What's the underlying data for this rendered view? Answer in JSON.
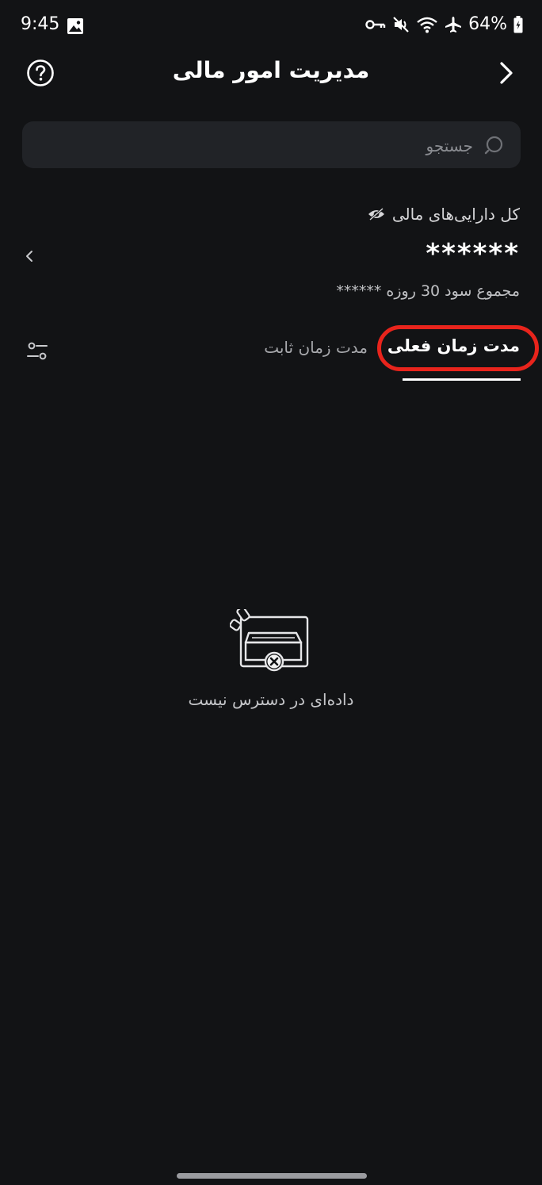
{
  "status_bar": {
    "time": "9:45",
    "battery_percent": "64%",
    "icons": [
      "gallery-icon",
      "vpn-key-icon",
      "muted-icon",
      "wifi-icon",
      "airplane-icon",
      "battery-icon"
    ]
  },
  "header": {
    "title": "مدیریت امور مالی",
    "help_icon": "question-circle-icon",
    "back_icon": "chevron-right-icon"
  },
  "search": {
    "placeholder": "جستجو",
    "value": ""
  },
  "assets": {
    "label": "کل دارایی‌های مالی",
    "value": "******",
    "profit_label": "مجموع سود 30 روزه",
    "profit_value": "******"
  },
  "tabs": [
    {
      "label": "مدت زمان فعلی",
      "active": true
    },
    {
      "label": "مدت زمان ثابت",
      "active": false
    }
  ],
  "empty_state": {
    "text": "داده‌ای در دسترس نیست"
  },
  "colors": {
    "background": "#121315",
    "search_background": "#212327",
    "highlight": "#e8241c",
    "text": "#ffffff"
  }
}
